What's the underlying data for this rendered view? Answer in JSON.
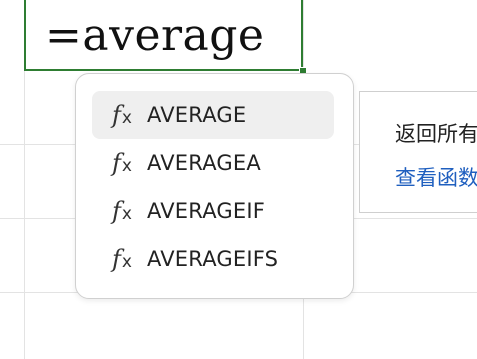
{
  "cell_editor": {
    "formula_text": "=average"
  },
  "autocomplete": {
    "items": [
      {
        "icon": "function-fx-icon",
        "label": "AVERAGE",
        "selected": true
      },
      {
        "icon": "function-fx-icon",
        "label": "AVERAGEA",
        "selected": false
      },
      {
        "icon": "function-fx-icon",
        "label": "AVERAGEIF",
        "selected": false
      },
      {
        "icon": "function-fx-icon",
        "label": "AVERAGEIFS",
        "selected": false
      }
    ],
    "fx_glyph": "f",
    "fx_sub": "x"
  },
  "tooltip": {
    "description": "返回所有",
    "link_text": "查看函数"
  },
  "colors": {
    "cell_border": "#2e7d32",
    "selected_item_bg": "#efefef",
    "link": "#1f5fbf"
  }
}
